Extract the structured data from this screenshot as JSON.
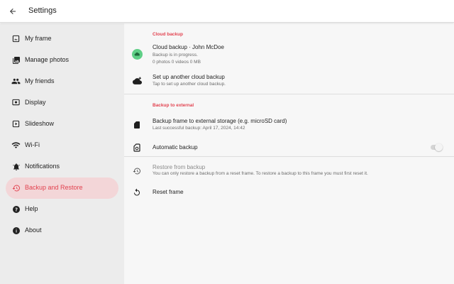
{
  "header": {
    "title": "Settings",
    "back_icon": "arrow-left-icon"
  },
  "colors": {
    "accent": "#e2424f",
    "active_nav_bg": "#f3d6d8",
    "sidebar_bg": "#ececec",
    "content_bg": "#f7f7f7",
    "cloud_icon_bg": "#5fcf86"
  },
  "sidebar": {
    "items": [
      {
        "label": "My frame",
        "icon": "frame-icon",
        "active": false
      },
      {
        "label": "Manage photos",
        "icon": "photo-library-icon",
        "active": false
      },
      {
        "label": "My friends",
        "icon": "people-icon",
        "active": false
      },
      {
        "label": "Display",
        "icon": "display-icon",
        "active": false
      },
      {
        "label": "Slideshow",
        "icon": "slideshow-icon",
        "active": false
      },
      {
        "label": "Wi-Fi",
        "icon": "wifi-icon",
        "active": false
      },
      {
        "label": "Notifications",
        "icon": "bell-icon",
        "active": false
      },
      {
        "label": "Backup and Restore",
        "icon": "restore-icon",
        "active": true
      },
      {
        "label": "Help",
        "icon": "help-icon",
        "active": false
      },
      {
        "label": "About",
        "icon": "info-icon",
        "active": false
      }
    ]
  },
  "main": {
    "cloud_section": {
      "heading": "Cloud backup",
      "account": {
        "title": "Cloud backup · John McDoe",
        "status": "Backup is in progress.",
        "counts": "0 photos 0 videos 0 MB",
        "icon": "cloud-sync-icon"
      },
      "add": {
        "title": "Set up another cloud backup",
        "subtitle": "Tap to set up another cloud backup.",
        "icon": "cloud-add-icon"
      }
    },
    "external_section": {
      "heading": "Backup to external",
      "backup": {
        "title": "Backup frame to external storage (e.g. microSD card)",
        "subtitle": "Last successful backup: April 17, 2024, 14:42",
        "icon": "sd-card-icon"
      },
      "automatic": {
        "title": "Automatic backup",
        "icon": "sd-card-auto-icon",
        "enabled": false
      }
    },
    "restore": {
      "title": "Restore from backup",
      "subtitle": "You can only restore a backup from a reset frame. To restore a backup to this frame you must first reset it.",
      "icon": "restore-icon",
      "enabled": false
    },
    "reset": {
      "title": "Reset frame",
      "icon": "reset-icon"
    }
  }
}
